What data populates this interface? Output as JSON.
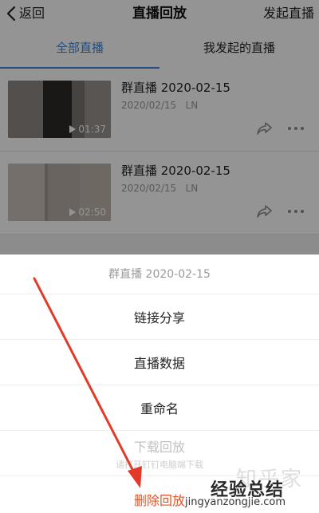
{
  "header": {
    "back_label": "返回",
    "title": "直播回放",
    "right_action": "发起直播"
  },
  "tabs": [
    {
      "label": "全部直播",
      "active": true
    },
    {
      "label": "我发起的直播",
      "active": false
    }
  ],
  "recordings": [
    {
      "title": "群直播 2020-02-15",
      "date": "2020/02/15",
      "host": "LN",
      "duration": "01:37"
    },
    {
      "title": "群直播 2020-02-15",
      "date": "2020/02/15",
      "host": "LN",
      "duration": "02:50"
    }
  ],
  "sheet": {
    "title": "群直播 2020-02-15",
    "options": {
      "share_link": "链接分享",
      "live_data": "直播数据",
      "rename": "重命名",
      "download": "下载回放",
      "download_hint": "请打开钉钉电脑端下载",
      "delete": "删除回放"
    }
  },
  "watermark": {
    "brand": "经验总结",
    "url": "jingyanzongjie.com",
    "faint": "知乎家"
  },
  "colors": {
    "accent": "#3b86d8",
    "danger": "#e0552b",
    "annotation_arrow": "#e23a2a"
  }
}
